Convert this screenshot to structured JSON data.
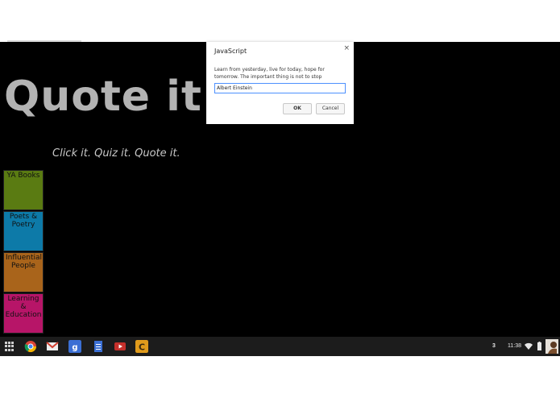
{
  "app": {
    "title": "Quote it",
    "tagline": "Click it. Quiz it. Quote it.",
    "categories": [
      {
        "label": "YA Books",
        "color": "#5a7b12"
      },
      {
        "label": "Poets & Poetry",
        "color": "#0d7aa8"
      },
      {
        "label": "Influential People",
        "color": "#a9641b"
      },
      {
        "label": "Learning & Education",
        "color": "#b71568"
      }
    ]
  },
  "dialog": {
    "title": "JavaScript",
    "close_icon": "×",
    "message": "Learn from yesterday, live for today, hope for tomorrow. The important thing is not to stop",
    "input_value": "Albert Einstein",
    "ok_label": "OK",
    "cancel_label": "Cancel"
  },
  "shelf": {
    "apps": [
      "launcher-icon",
      "chrome-icon",
      "gmail-icon",
      "google-search-icon",
      "docs-icon",
      "youtube-icon",
      "app-c-icon"
    ],
    "notification_count": "3",
    "time": "11:38"
  }
}
